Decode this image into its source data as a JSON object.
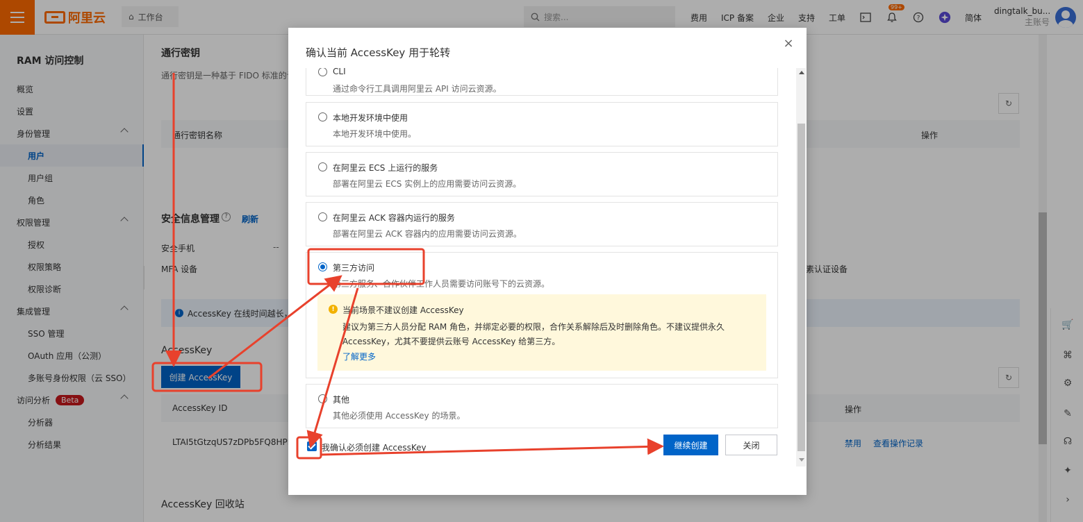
{
  "topbar": {
    "logo_text": "阿里云",
    "workbench": "工作台",
    "search_placeholder": "搜索...",
    "links": [
      "费用",
      "ICP 备案",
      "企业",
      "支持",
      "工单"
    ],
    "notification_badge": "99+",
    "language": "简体",
    "user_name": "dingtalk_bu...",
    "user_role": "主账号"
  },
  "sidebar": {
    "title": "RAM 访问控制",
    "items": [
      {
        "label": "概览",
        "level": 1
      },
      {
        "label": "设置",
        "level": 1
      },
      {
        "label": "身份管理",
        "level": 1,
        "expandable": true
      },
      {
        "label": "用户",
        "level": 2,
        "active": true
      },
      {
        "label": "用户组",
        "level": 2
      },
      {
        "label": "角色",
        "level": 2
      },
      {
        "label": "权限管理",
        "level": 1,
        "expandable": true
      },
      {
        "label": "授权",
        "level": 2
      },
      {
        "label": "权限策略",
        "level": 2
      },
      {
        "label": "权限诊断",
        "level": 2
      },
      {
        "label": "集成管理",
        "level": 1,
        "expandable": true
      },
      {
        "label": "SSO 管理",
        "level": 2
      },
      {
        "label": "OAuth 应用（公测）",
        "level": 2
      },
      {
        "label": "多账号身份权限（云 SSO）",
        "level": 2
      },
      {
        "label": "访问分析",
        "level": 1,
        "expandable": true,
        "badge": "Beta"
      },
      {
        "label": "分析器",
        "level": 2
      },
      {
        "label": "分析结果",
        "level": 2
      }
    ]
  },
  "background": {
    "passkey_title": "通行密钥",
    "passkey_desc": "通行密钥是一种基于 FIDO 标准的认",
    "passkey_col_name": "通行密钥名称",
    "passkey_col_action": "操作",
    "security_title": "安全信息管理",
    "security_refresh": "刷新",
    "security_phone": "安全手机",
    "security_phone_value": "--",
    "security_mfa": "MFA 设备",
    "security_mfa_right": "素认证设备",
    "info_text": "AccessKey 在线时间越长，泄",
    "accesskey_title": "AccessKey",
    "create_button": "创建 AccessKey",
    "ak_col_id": "AccessKey ID",
    "ak_col_action": "操作",
    "ak_id": "LTAI5tGtzqUS7zDPb5FQ8HPH",
    "ak_action_disable": "禁用",
    "ak_action_log": "查看操作记录",
    "recycle_title": "AccessKey 回收站"
  },
  "modal": {
    "title": "确认当前 AccessKey 用于轮转",
    "options": [
      {
        "label": "CLI",
        "desc": "通过命令行工具调用阿里云 API 访问云资源。",
        "checked": false
      },
      {
        "label": "本地开发环境中使用",
        "desc": "本地开发环境中使用。",
        "checked": false
      },
      {
        "label": "在阿里云 ECS 上运行的服务",
        "desc": "部署在阿里云 ECS 实例上的应用需要访问云资源。",
        "checked": false
      },
      {
        "label": "在阿里云 ACK 容器内运行的服务",
        "desc": "部署在阿里云 ACK 容器内的应用需要访问云资源。",
        "checked": false
      },
      {
        "label": "第三方访问",
        "desc": "第三方服务、合作伙伴工作人员需要访问账号下的云资源。",
        "checked": true
      },
      {
        "label": "其他",
        "desc": "其他必须使用 AccessKey 的场景。",
        "checked": false
      }
    ],
    "warning": {
      "title": "当前场景不建议创建 AccessKey",
      "text": "建议为第三方人员分配 RAM 角色，并绑定必要的权限，合作关系解除后及时删除角色。不建议提供永久 AccessKey，尤其不要提供云账号 AccessKey 给第三方。",
      "link": "了解更多"
    },
    "confirm_label": "我确认必须创建 AccessKey",
    "continue_button": "继续创建",
    "close_button": "关闭"
  },
  "colors": {
    "brand": "#ff6a00",
    "primary": "#0064c8",
    "annotation": "#e8412c"
  }
}
